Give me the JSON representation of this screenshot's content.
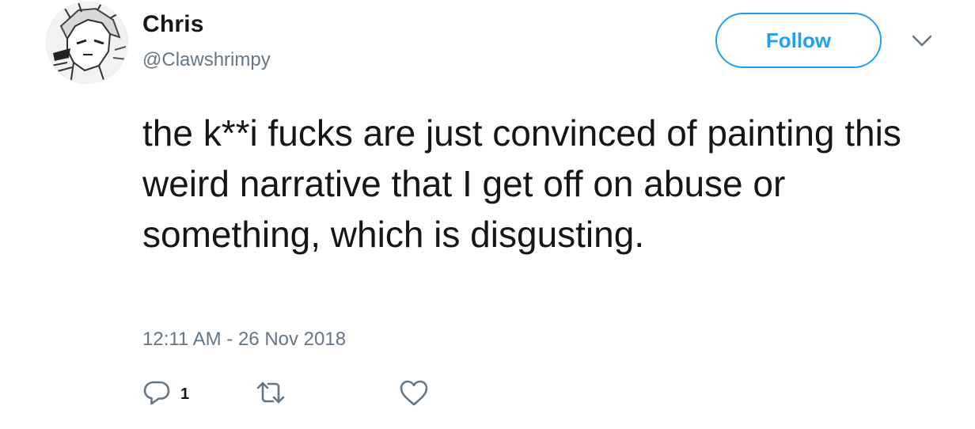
{
  "author": {
    "display_name": "Chris",
    "screen_name": "@Clawshrimpy",
    "avatar_icon": "anime-character-avatar"
  },
  "follow_button": {
    "label": "Follow",
    "color": "#1da1f2"
  },
  "menu": {
    "icon": "chevron-down-icon"
  },
  "tweet": {
    "text": "the k**i fucks are just convinced of painting this weird narrative that I get off on abuse or something, which is disgusting.",
    "timestamp": "12:11 AM - 26 Nov 2018"
  },
  "actions": {
    "reply": {
      "icon": "reply-icon",
      "count": "1"
    },
    "retweet": {
      "icon": "retweet-icon"
    },
    "like": {
      "icon": "heart-icon"
    }
  },
  "colors": {
    "text": "#14171a",
    "secondary_text": "#657786",
    "accent": "#1da1f2"
  }
}
